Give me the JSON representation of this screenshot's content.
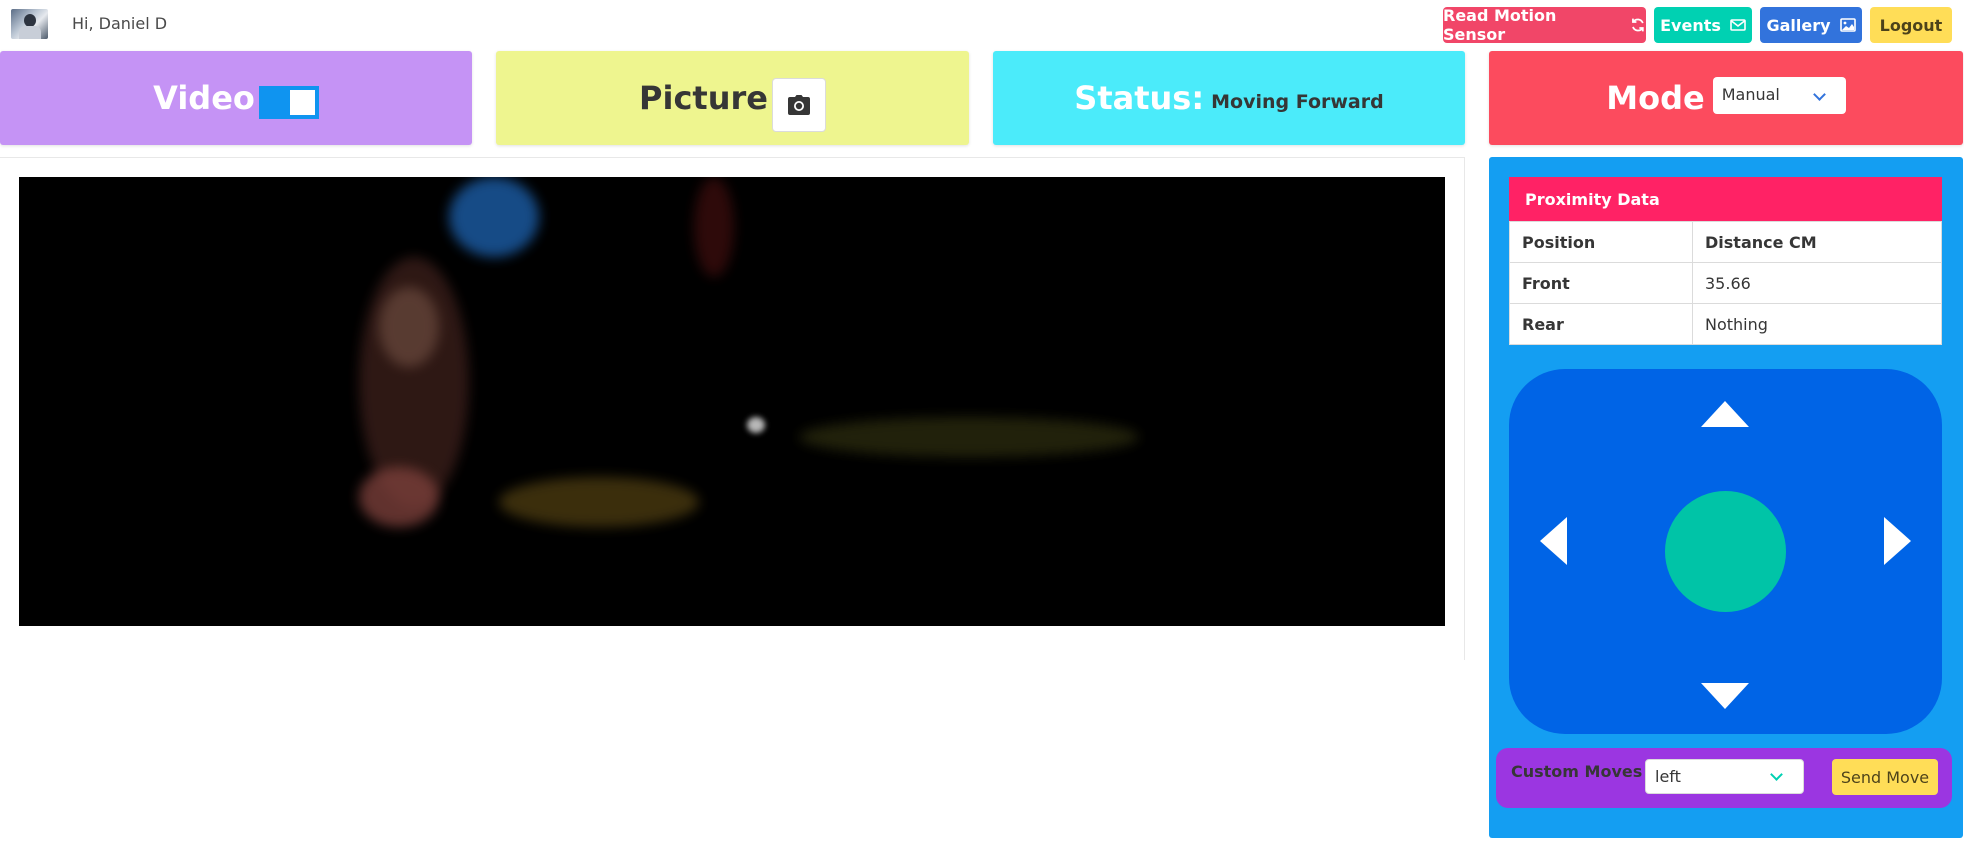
{
  "header": {
    "greeting": "Hi, Daniel D",
    "buttons": {
      "motion": {
        "label": "Read Motion Sensor",
        "icon": "refresh-icon",
        "color": "#f14668"
      },
      "events": {
        "label": "Events",
        "icon": "envelope-icon",
        "color": "#00d1b2"
      },
      "gallery": {
        "label": "Gallery",
        "icon": "image-icon",
        "color": "#3273dc"
      },
      "logout": {
        "label": "Logout",
        "color": "#ffdd57"
      }
    }
  },
  "tiles": {
    "video": {
      "title": "Video",
      "toggle_on": true,
      "color": "#c593f5"
    },
    "picture": {
      "title": "Picture",
      "icon": "camera-icon",
      "color": "#eef58f"
    },
    "status": {
      "title": "Status:",
      "value": "Moving Forward",
      "color": "#4bebfa"
    },
    "mode": {
      "title": "Mode",
      "selected": "Manual",
      "color": "#fc4b5e"
    }
  },
  "proximity": {
    "header": "Proximity Data",
    "columns": [
      "Position",
      "Distance CM"
    ],
    "rows": [
      {
        "position": "Front",
        "distance": "35.66"
      },
      {
        "position": "Rear",
        "distance": "Nothing"
      }
    ]
  },
  "controls": {
    "icons": [
      "arrow-up-icon",
      "arrow-down-icon",
      "arrow-left-icon",
      "arrow-right-icon",
      "stop-button"
    ]
  },
  "custom_moves": {
    "label": "Custom Moves",
    "selected": "left",
    "send_label": "Send Move"
  }
}
